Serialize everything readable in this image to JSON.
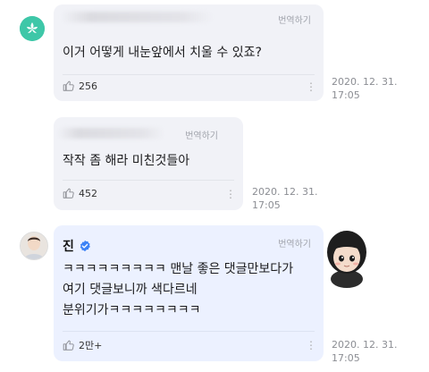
{
  "comments": [
    {
      "translate": "번역하기",
      "text": "이거 어떻게 내눈앞에서 치울 수 있죠?",
      "likes": "256",
      "date": "2020. 12. 31.",
      "time": "17:05"
    },
    {
      "translate": "번역하기",
      "text": "작작 좀 해라 미친것들아",
      "likes": "452",
      "date": "2020. 12. 31.",
      "time": "17:05"
    },
    {
      "author": "진",
      "translate": "번역하기",
      "lines": [
        "ㅋㅋㅋㅋㅋㅋㅋㅋㅋ 맨날 좋은 댓글만보다가",
        "여기 댓글보니까 색다르네",
        "분위기가ㅋㅋㅋㅋㅋㅋㅋㅋ"
      ],
      "likes": "2만+",
      "date": "2020. 12. 31.",
      "time": "17:05"
    }
  ],
  "icons": {
    "like": "thumbs-up-icon",
    "more": "more-vertical-icon",
    "verified": "verified-badge-icon"
  },
  "colors": {
    "fan_bubble": "#f1f2f7",
    "artist_bubble": "#ecf1ff",
    "verified": "#3b82f6",
    "app_avatar": "#39c5a6"
  }
}
